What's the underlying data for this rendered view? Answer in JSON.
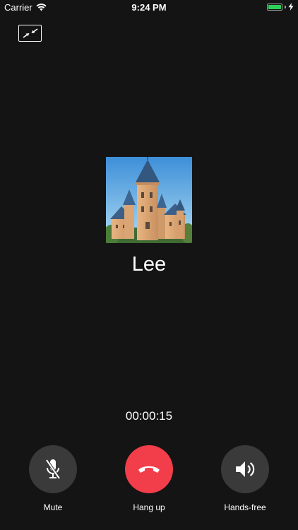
{
  "status_bar": {
    "carrier": "Carrier",
    "time": "9:24 PM",
    "battery_level": 1.0
  },
  "call": {
    "caller_name": "Lee",
    "timer": "00:00:15"
  },
  "controls": {
    "mute_label": "Mute",
    "hangup_label": "Hang up",
    "handsfree_label": "Hands-free"
  },
  "colors": {
    "background": "#141414",
    "control_gray": "#3a3a3a",
    "hangup_red": "#f23d4a",
    "battery_green": "#2ed158"
  },
  "icons": {
    "minimize": "minimize-arrows-icon",
    "mute": "microphone-off-icon",
    "hangup": "phone-hangup-icon",
    "speaker": "speaker-icon",
    "wifi": "wifi-icon",
    "charge": "charging-bolt-icon"
  }
}
